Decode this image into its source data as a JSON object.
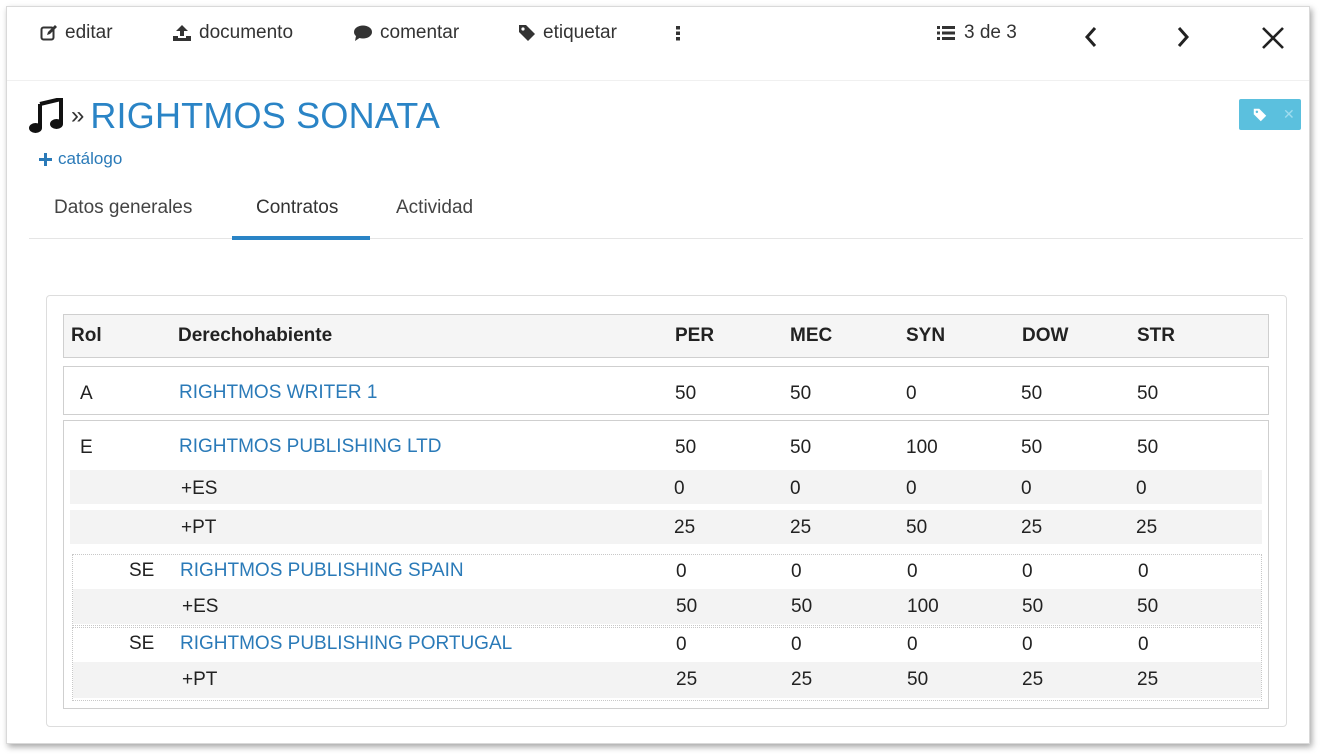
{
  "toolbar": {
    "edit": "editar",
    "document": "documento",
    "comment": "comentar",
    "tag": "etiquetar",
    "counter": "3 de 3"
  },
  "header": {
    "raquo": "»",
    "title": "RIGHTMOS SONATA",
    "catalog": "catálogo"
  },
  "tabs": [
    "Datos generales",
    "Contratos",
    "Actividad"
  ],
  "table": {
    "headers": [
      "Rol",
      "Derechohabiente",
      "PER",
      "MEC",
      "SYN",
      "DOW",
      "STR"
    ],
    "rows": [
      {
        "role": "A",
        "name": "RIGHTMOS WRITER 1",
        "v": [
          "50",
          "50",
          "0",
          "50",
          "50"
        ]
      },
      {
        "role": "E",
        "name": "RIGHTMOS PUBLISHING LTD",
        "v": [
          "50",
          "50",
          "100",
          "50",
          "50"
        ]
      },
      {
        "role": "",
        "name": "+ES",
        "v": [
          "0",
          "0",
          "0",
          "0",
          "0"
        ]
      },
      {
        "role": "",
        "name": "+PT",
        "v": [
          "25",
          "25",
          "50",
          "25",
          "25"
        ]
      },
      {
        "role": "SE",
        "name": "RIGHTMOS PUBLISHING SPAIN",
        "v": [
          "0",
          "0",
          "0",
          "0",
          "0"
        ]
      },
      {
        "role": "",
        "name": "+ES",
        "v": [
          "50",
          "50",
          "100",
          "50",
          "50"
        ]
      },
      {
        "role": "SE",
        "name": "RIGHTMOS PUBLISHING PORTUGAL",
        "v": [
          "0",
          "0",
          "0",
          "0",
          "0"
        ]
      },
      {
        "role": "",
        "name": "+PT",
        "v": [
          "25",
          "25",
          "50",
          "25",
          "25"
        ]
      }
    ]
  },
  "colors": {
    "accent": "#2a84c6",
    "link": "#2a7ab8",
    "badge": "#5bc0de"
  }
}
